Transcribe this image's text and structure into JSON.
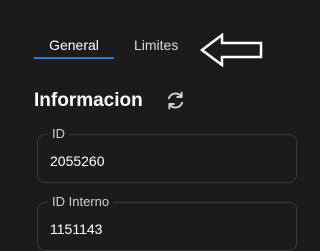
{
  "tabs": [
    {
      "label": "General",
      "active": true
    },
    {
      "label": "Limites",
      "active": false
    }
  ],
  "accent_color": "#1f7ae0",
  "arrow_icon": "arrow-left-outline-icon",
  "section": {
    "title": "Informacion",
    "refresh_icon": "refresh-icon"
  },
  "fields": [
    {
      "label": "ID",
      "value": "2055260"
    },
    {
      "label": "ID Interno",
      "value": "1151143"
    }
  ]
}
